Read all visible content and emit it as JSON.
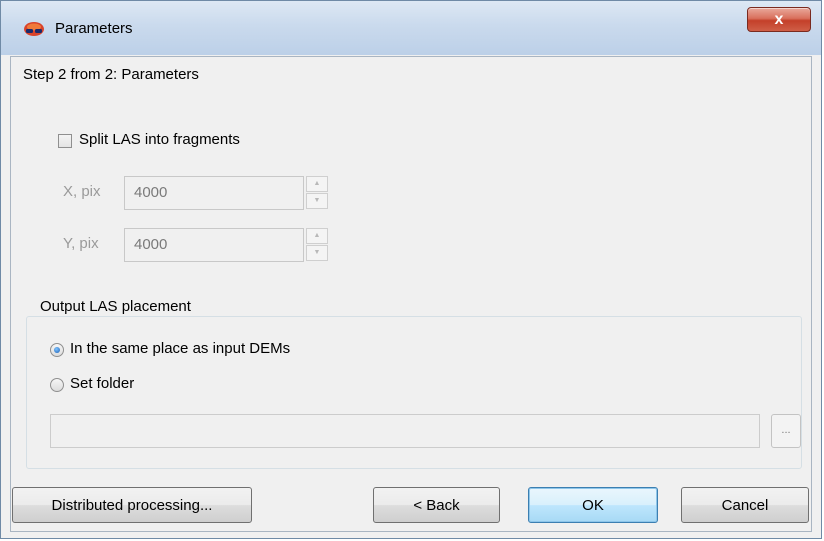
{
  "window": {
    "title": "Parameters",
    "close_label": "x"
  },
  "step_label": "Step 2 from 2: Parameters",
  "split": {
    "checkbox_label": "Split LAS into fragments",
    "checked": false,
    "x_label": "X, pix",
    "x_value": "4000",
    "y_label": "Y, pix",
    "y_value": "4000"
  },
  "output": {
    "group_title": "Output LAS placement",
    "option_same_place": "In the same place as input DEMs",
    "option_set_folder": "Set folder",
    "selected": "same_place",
    "folder_path": "",
    "browse_label": "..."
  },
  "buttons": {
    "distributed": "Distributed processing...",
    "back": "< Back",
    "ok": "OK",
    "cancel": "Cancel"
  },
  "colors": {
    "title_gradient_top": "#dde8f4",
    "close_button": "#c4402a",
    "default_button_border": "#3c7fb1",
    "disabled_text": "#9a9a9a"
  }
}
